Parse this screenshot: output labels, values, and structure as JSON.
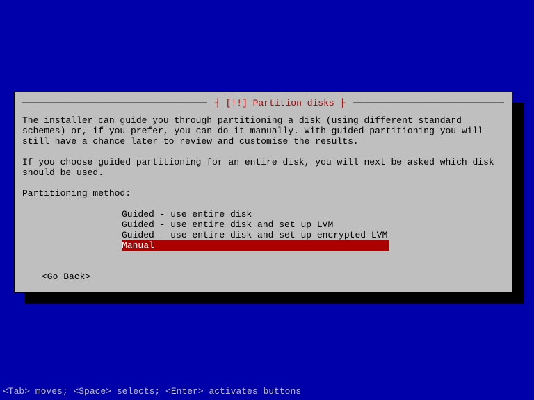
{
  "dialog": {
    "title": "[!!] Partition disks",
    "para1": "The installer can guide you through partitioning a disk (using different standard schemes) or, if you prefer, you can do it manually. With guided partitioning you will still have a chance later to review and customise the results.",
    "para2": "If you choose guided partitioning for an entire disk, you will next be asked which disk should be used.",
    "method_label": "Partitioning method:",
    "options": [
      "Guided - use entire disk",
      "Guided - use entire disk and set up LVM",
      "Guided - use entire disk and set up encrypted LVM",
      "Manual"
    ],
    "selected_index": 3,
    "go_back": "<Go Back>"
  },
  "helpbar": "<Tab> moves; <Space> selects; <Enter> activates buttons"
}
